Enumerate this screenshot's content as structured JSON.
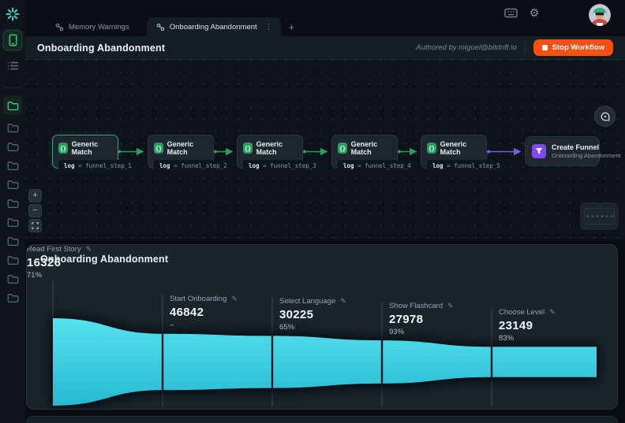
{
  "topbar": {
    "tabs": [
      {
        "label": "Memory Warnings",
        "active": false
      },
      {
        "label": "Onboarding Abandonment",
        "active": true
      }
    ],
    "new_tab": "+",
    "kebab": "⋮"
  },
  "header": {
    "title": "Onboarding Abandonment",
    "authored": "Authored by miguel@bitdrift.io",
    "stop_label": "Stop Workflow"
  },
  "sidebar": {
    "folders": [
      {
        "active": true
      },
      {
        "active": false
      },
      {
        "active": false
      },
      {
        "active": false
      },
      {
        "active": false
      },
      {
        "active": false
      },
      {
        "active": false
      },
      {
        "active": false
      },
      {
        "active": false
      },
      {
        "active": false
      },
      {
        "active": false
      }
    ]
  },
  "canvas": {
    "nodes": [
      {
        "title": "Generic Match",
        "key": "log",
        "op": "=",
        "value": "funnel_step_1",
        "selected": true
      },
      {
        "title": "Generic Match",
        "key": "log",
        "op": "=",
        "value": "funnel_step_2",
        "selected": false
      },
      {
        "title": "Generic Match",
        "key": "log",
        "op": "=",
        "value": "funnel_step_3",
        "selected": false
      },
      {
        "title": "Generic Match",
        "key": "log",
        "op": "=",
        "value": "funnel_step_4",
        "selected": false
      },
      {
        "title": "Generic Match",
        "key": "log",
        "op": "=",
        "value": "funnel_step_5",
        "selected": false
      }
    ],
    "output_node": {
      "title": "Create Funnel",
      "subtitle": "Onboarding Abandonment"
    },
    "zoom_in": "+",
    "zoom_out": "−"
  },
  "funnel": {
    "title": "Onboarding Abandonment",
    "steps": [
      {
        "label": "Start Onboarding",
        "value": "46842",
        "pct": "–"
      },
      {
        "label": "Select Language",
        "value": "30225",
        "pct": "65%"
      },
      {
        "label": "Show Flashcard",
        "value": "27978",
        "pct": "93%"
      },
      {
        "label": "Choose Level",
        "value": "23149",
        "pct": "83%"
      },
      {
        "label": "Read First Story",
        "value": "16326",
        "pct": "71%"
      }
    ]
  },
  "chart_data": {
    "type": "funnel",
    "title": "Onboarding Abandonment",
    "categories": [
      "Start Onboarding",
      "Select Language",
      "Show Flashcard",
      "Choose Level",
      "Read First Story"
    ],
    "values": [
      46842,
      30225,
      27978,
      23149,
      16326
    ],
    "conversion_pct_from_previous": [
      null,
      65,
      93,
      83,
      71
    ],
    "fill_color": "#3bd4e6",
    "orientation": "horizontal-area"
  },
  "colors": {
    "accent_green": "#23a05f",
    "selected_teal": "#2f9f7f",
    "accent_purple": "#8148f0",
    "stop_orange": "#f4500f",
    "funnel_cyan": "#3bd4e6",
    "panel_bg": "#1b232c"
  }
}
